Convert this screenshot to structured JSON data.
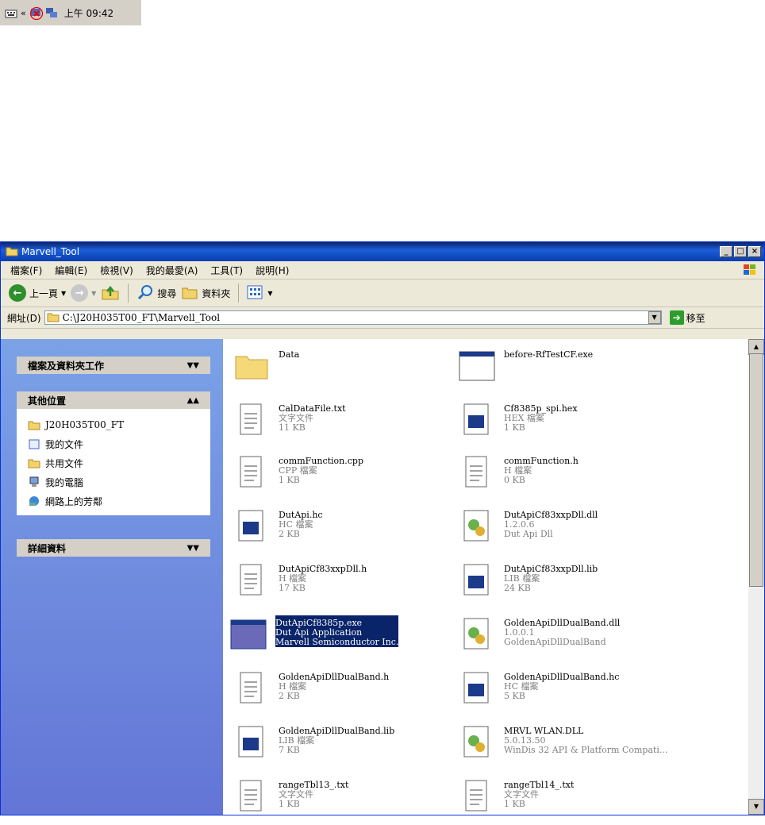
{
  "tray": {
    "time": "上午 09:42"
  },
  "window": {
    "title": "Marvell_Tool",
    "menu": [
      "檔案(F)",
      "編輯(E)",
      "檢視(V)",
      "我的最愛(A)",
      "工具(T)",
      "說明(H)"
    ],
    "toolbar": {
      "back": "上一頁",
      "search": "搜尋",
      "folders": "資料夾"
    },
    "address": {
      "label": "網址(D)",
      "value": "C:\\J20H035T00_FT\\Marvell_Tool",
      "go": "移至"
    }
  },
  "taskpane": {
    "sections": [
      {
        "title": "檔案及資料夾工作",
        "links": []
      },
      {
        "title": "其他位置",
        "links": [
          "J20H035T00_FT",
          "我的文件",
          "共用文件",
          "我的電腦",
          "網路上的芳鄰"
        ]
      },
      {
        "title": "詳細資料",
        "links": []
      }
    ]
  },
  "files": [
    {
      "name": "Data",
      "l2": "",
      "l3": "",
      "icon": "folder-icon"
    },
    {
      "name": "before-RfTestCF.exe",
      "l2": "",
      "l3": "",
      "icon": "exe-icon"
    },
    {
      "name": "CalDataFile.txt",
      "l2": "文字文件",
      "l3": "11 KB",
      "icon": "text-file-icon"
    },
    {
      "name": "Cf8385p_spi.hex",
      "l2": "HEX 檔案",
      "l3": "1 KB",
      "icon": "file-icon"
    },
    {
      "name": "commFunction.cpp",
      "l2": "CPP 檔案",
      "l3": "1 KB",
      "icon": "text-file-icon"
    },
    {
      "name": "commFunction.h",
      "l2": "H 檔案",
      "l3": "0 KB",
      "icon": "text-file-icon"
    },
    {
      "name": "DutApi.hc",
      "l2": "HC 檔案",
      "l3": "2 KB",
      "icon": "file-icon"
    },
    {
      "name": "DutApiCf83xxpDll.dll",
      "l2": "1.2.0.6",
      "l3": "Dut Api Dll",
      "icon": "dll-icon"
    },
    {
      "name": "DutApiCf83xxpDll.h",
      "l2": "H 檔案",
      "l3": "17 KB",
      "icon": "text-file-icon"
    },
    {
      "name": "DutApiCf83xxpDll.lib",
      "l2": "LIB 檔案",
      "l3": "24 KB",
      "icon": "file-icon"
    },
    {
      "name": "DutApiCf8385p.exe",
      "l2": "Dut Api Application",
      "l3": "Marvell Semiconductor Inc.",
      "icon": "exe-icon",
      "selected": true
    },
    {
      "name": "GoldenApiDllDualBand.dll",
      "l2": "1.0.0.1",
      "l3": "GoldenApiDllDualBand",
      "icon": "dll-icon"
    },
    {
      "name": "GoldenApiDllDualBand.h",
      "l2": "H 檔案",
      "l3": "2 KB",
      "icon": "text-file-icon"
    },
    {
      "name": "GoldenApiDllDualBand.hc",
      "l2": "HC 檔案",
      "l3": "5 KB",
      "icon": "file-icon"
    },
    {
      "name": "GoldenApiDllDualBand.lib",
      "l2": "LIB 檔案",
      "l3": "7 KB",
      "icon": "file-icon"
    },
    {
      "name": "MRVL WLAN.DLL",
      "l2": "5.0.13.50",
      "l3": "WinDis 32 API & Platform Compati...",
      "icon": "dll-icon"
    },
    {
      "name": "rangeTbl13_.txt",
      "l2": "文字文件",
      "l3": "1 KB",
      "icon": "text-file-icon"
    },
    {
      "name": "rangeTbl14_.txt",
      "l2": "文字文件",
      "l3": "1 KB",
      "icon": "text-file-icon"
    }
  ]
}
